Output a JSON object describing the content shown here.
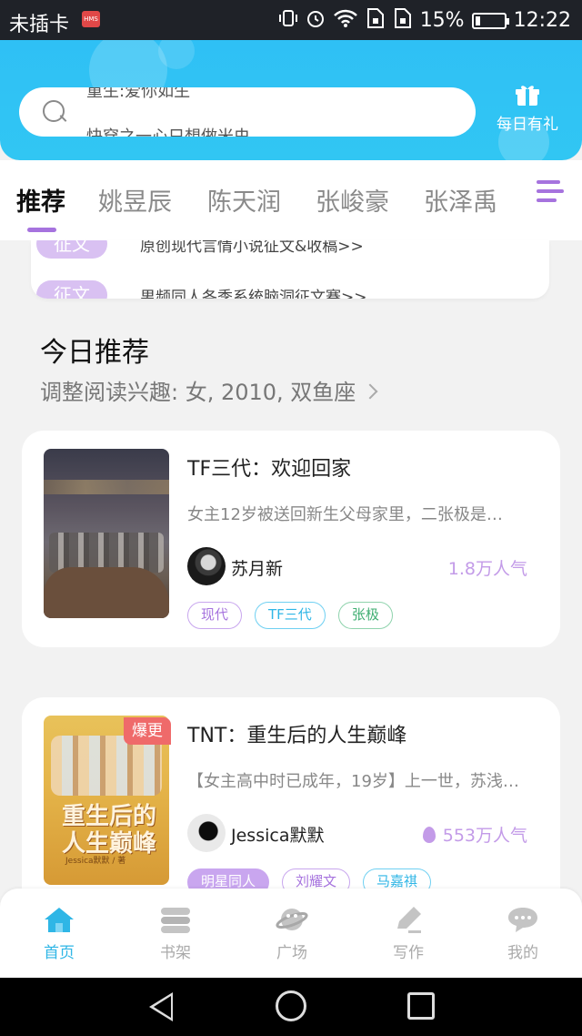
{
  "status_bar": {
    "carrier": "未插卡",
    "hms_badge": "HMS",
    "battery_percent": "15%",
    "battery_level": 0.15,
    "time": "12:22",
    "icons": [
      "vibrate-icon",
      "alarm-icon",
      "wifi-icon",
      "sim-icon",
      "sim-icon",
      "battery-icon"
    ]
  },
  "header": {
    "search_hints": [
      "重生:爱你如生",
      "快穿之一心只想做米虫"
    ],
    "gift_label": "每日有礼",
    "accent": "#31c4f3"
  },
  "tabs": {
    "items": [
      "推荐",
      "姚昱辰",
      "陈天润",
      "张峻豪",
      "张泽禹"
    ],
    "active_index": 0,
    "accent": "#a673de"
  },
  "notices": [
    {
      "tag": "征文",
      "text": "原创现代言情小说征文&收稿>>"
    },
    {
      "tag": "征文",
      "text": "男频同人各季系统脑洞征文赛>>"
    }
  ],
  "section": {
    "title": "今日推荐",
    "subtitle": "调整阅读兴趣: 女, 2010, 双鱼座"
  },
  "books": [
    {
      "title": "TF三代：欢迎回家",
      "description": "女主12岁被送回新生父母家里，二张极是…",
      "author": "苏月新",
      "popularity": "1.8万人气",
      "badge": "",
      "tags": [
        "现代",
        "TF三代",
        "张极"
      ]
    },
    {
      "title": "TNT：重生后的人生巅峰",
      "description": "【女主高中时已成年，19岁】上一世，苏浅…",
      "author": "Jessica默默",
      "popularity": "553万人气",
      "badge": "爆更",
      "cover_title": "重生后的人生巅峰",
      "cover_author": "Jessica默默 / 著",
      "tags": [
        "明星同人",
        "刘耀文",
        "马嘉祺"
      ]
    }
  ],
  "bottom_nav": {
    "items": [
      "首页",
      "书架",
      "广场",
      "写作",
      "我的"
    ],
    "active_index": 0,
    "active_color": "#2fb6e6"
  }
}
